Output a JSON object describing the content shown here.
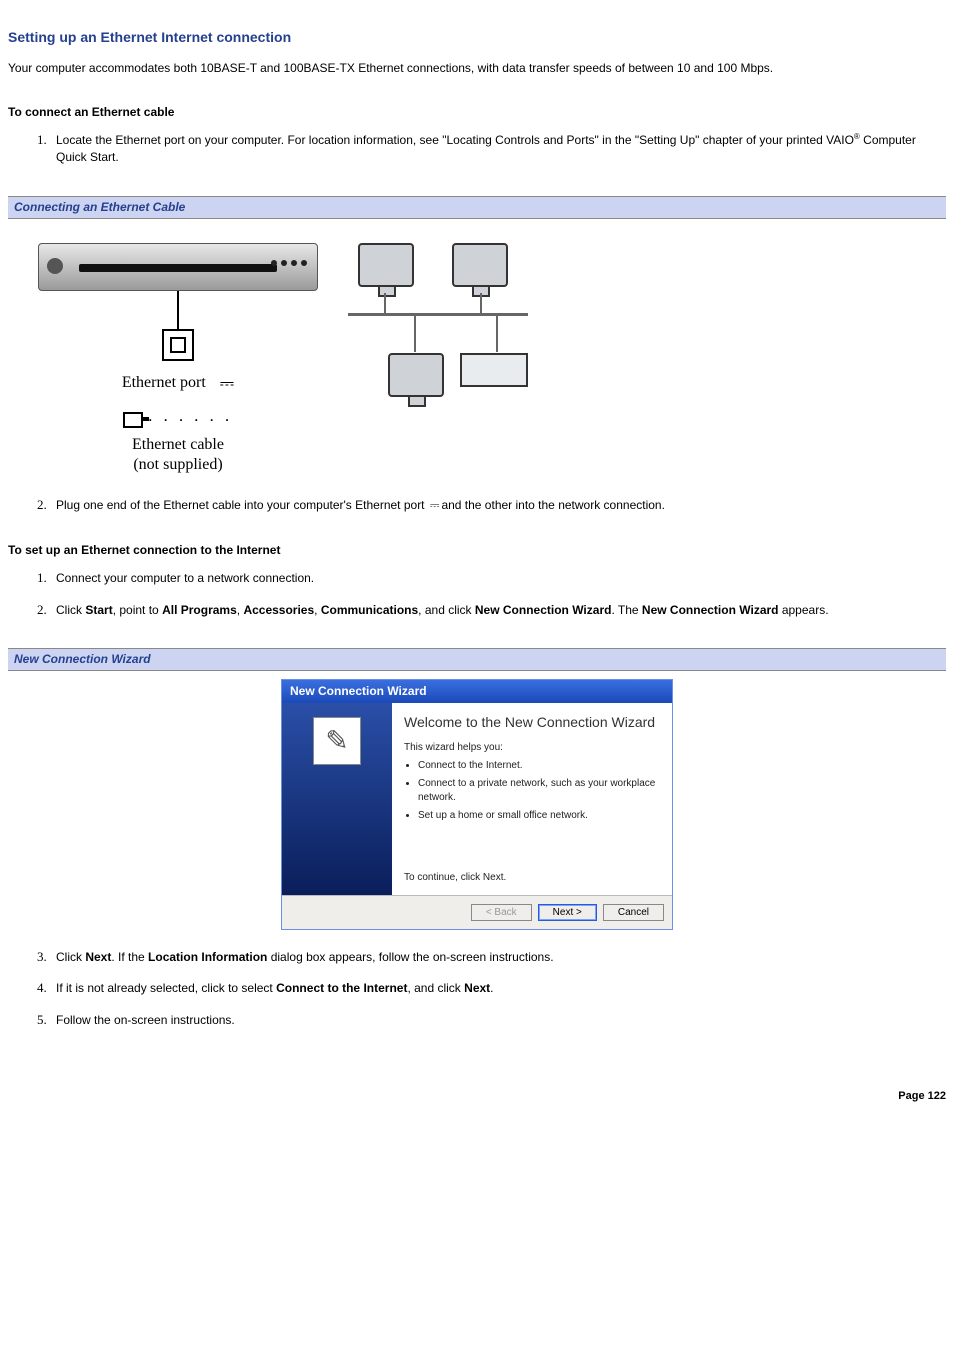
{
  "heading": "Setting up an Ethernet Internet connection",
  "intro": "Your computer accommodates both 10BASE-T and 100BASE-TX Ethernet connections, with data transfer speeds of between 10 and 100 Mbps.",
  "sub1": "To connect an Ethernet cable",
  "step1a_pre": "Locate the Ethernet port on your computer. For location information, see \"Locating Controls and Ports\" in the \"Setting Up\" chapter of your printed VAIO",
  "step1a_post": " Computer Quick Start.",
  "reg": "®",
  "caption1": "Connecting an Ethernet Cable",
  "fig": {
    "port_label": "Ethernet port",
    "cable_label1": "Ethernet cable",
    "cable_label2": "(not supplied)"
  },
  "step1b_pre": "Plug one end of the Ethernet cable into your computer's Ethernet port ",
  "step1b_post": "and the other into the network connection.",
  "sub2": "To set up an Ethernet connection to the Internet",
  "s2_1": "Connect your computer to a network connection.",
  "s2_2": {
    "a": "Click ",
    "b1": "Start",
    "c": ", point to ",
    "b2": "All Programs",
    "d": ", ",
    "b3": "Accessories",
    "e": ", ",
    "b4": "Communications",
    "f": ", and click ",
    "b5": "New Connection Wizard",
    "g": ". The ",
    "b6": "New Connection Wizard",
    "h": " appears."
  },
  "caption2": "New Connection Wizard",
  "wizard": {
    "title": "New Connection Wizard",
    "welcome": "Welcome to the New Connection Wizard",
    "helps": "This wizard helps you:",
    "b1": "Connect to the Internet.",
    "b2": "Connect to a private network, such as your workplace network.",
    "b3": "Set up a home or small office network.",
    "continue": "To continue, click Next.",
    "back": "< Back",
    "next": "Next >",
    "cancel": "Cancel"
  },
  "s2_3": {
    "a": "Click ",
    "b1": "Next",
    "c": ". If the ",
    "b2": "Location Information",
    "d": " dialog box appears, follow the on-screen instructions."
  },
  "s2_4": {
    "a": "If it is not already selected, click to select ",
    "b1": "Connect to the Internet",
    "c": ", and click ",
    "b2": "Next",
    "d": "."
  },
  "s2_5": "Follow the on-screen instructions.",
  "pagenum": "Page 122"
}
